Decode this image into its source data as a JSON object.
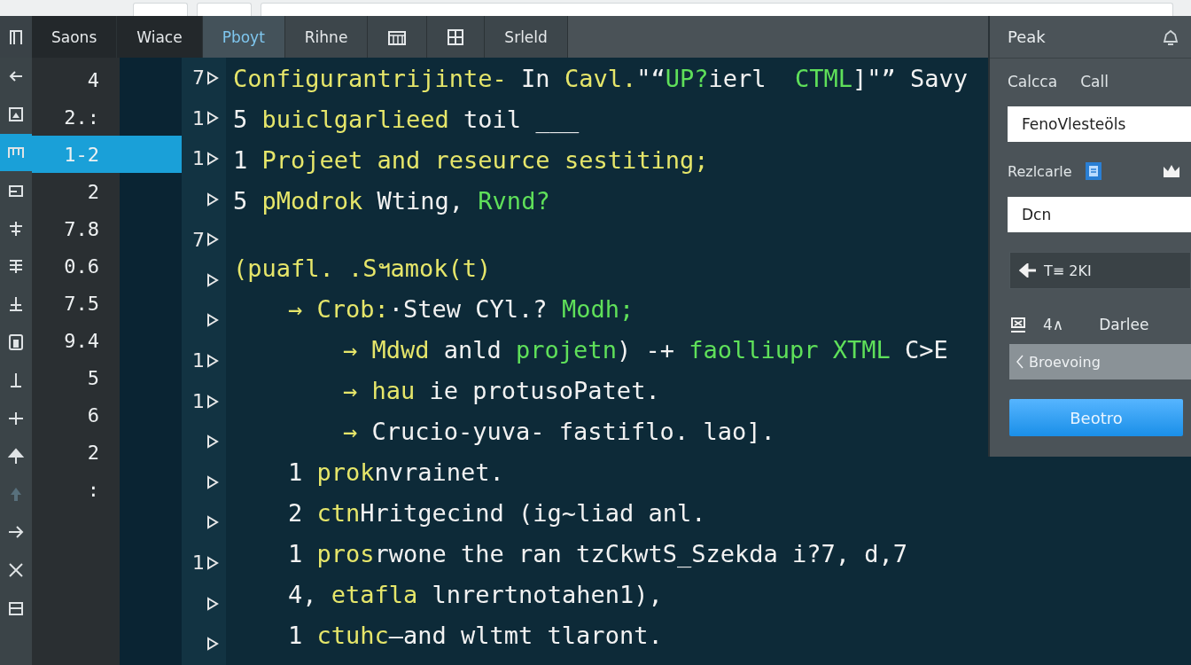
{
  "tab_bar": {
    "tabs": [
      {
        "kind": "text",
        "label": "Saons",
        "selected": false,
        "pinned": true
      },
      {
        "kind": "text",
        "label": "Wiace",
        "selected": false,
        "pinned": true
      },
      {
        "kind": "text",
        "label": "Pboyt",
        "selected": true,
        "pinned": false
      },
      {
        "kind": "text",
        "label": "Rihne",
        "selected": false,
        "pinned": false
      },
      {
        "kind": "icon",
        "selected": false,
        "pinned": false
      },
      {
        "kind": "icon",
        "selected": false,
        "pinned": false
      },
      {
        "kind": "text",
        "label": "Srleld",
        "selected": false,
        "pinned": false
      }
    ]
  },
  "activity_bar": {
    "items": [
      {
        "selected": false
      },
      {
        "selected": false
      },
      {
        "selected": true
      },
      {
        "selected": false
      },
      {
        "selected": false
      },
      {
        "selected": false
      },
      {
        "selected": false
      },
      {
        "selected": false
      },
      {
        "selected": false
      },
      {
        "selected": false
      },
      {
        "selected": false
      },
      {
        "selected": false
      },
      {
        "selected": false
      },
      {
        "selected": false
      },
      {
        "selected": false
      }
    ]
  },
  "values": [
    {
      "text": "4",
      "selected": false
    },
    {
      "text": "2.:",
      "selected": false
    },
    {
      "text": "1-2",
      "selected": true
    },
    {
      "text": "2",
      "selected": false
    },
    {
      "text": "7.8",
      "selected": false
    },
    {
      "text": "0.6",
      "selected": false
    },
    {
      "text": "7.5",
      "selected": false
    },
    {
      "text": "9.4",
      "selected": false
    },
    {
      "text": "5",
      "selected": false
    },
    {
      "text": "6",
      "selected": false
    },
    {
      "text": "2",
      "selected": false
    },
    {
      "text": ":",
      "selected": false
    }
  ],
  "gutter": [
    {
      "kind": "counted",
      "count": "7"
    },
    {
      "kind": "counted",
      "count": "1"
    },
    {
      "kind": "counted",
      "count": "1"
    },
    {
      "kind": "plain"
    },
    {
      "kind": "counted",
      "count": "7"
    },
    {
      "kind": "plain"
    },
    {
      "kind": "plain"
    },
    {
      "kind": "counted",
      "count": "1"
    },
    {
      "kind": "counted",
      "count": "1"
    },
    {
      "kind": "plain"
    },
    {
      "kind": "plain"
    },
    {
      "kind": "plain"
    },
    {
      "kind": "counted",
      "count": "1"
    },
    {
      "kind": "plain"
    },
    {
      "kind": "plain"
    }
  ],
  "code": [
    {
      "segments": [
        {
          "text": "Configurantrijinte-",
          "color": "#e6e66a"
        },
        {
          "text": " In ",
          "color": "#f2f2f2"
        },
        {
          "text": "Cavl.",
          "color": "#e6e66a"
        },
        {
          "text": "\"“",
          "color": "#f2f2f2"
        },
        {
          "text": "UP?",
          "color": "#5fe05a"
        },
        {
          "text": "ierl  ",
          "color": "#f2f2f2"
        },
        {
          "text": "CTML",
          "color": "#5fe05a"
        },
        {
          "text": "]\"” Savy",
          "color": "#f2f2f2"
        }
      ]
    },
    {
      "segments": [
        {
          "text": "5 ",
          "color": "#f2f2f2"
        },
        {
          "text": "buiclgarlieed",
          "color": "#e6e66a"
        },
        {
          "text": " toil ___",
          "color": "#f2f2f2"
        }
      ]
    },
    {
      "segments": [
        {
          "text": "1 ",
          "color": "#f2f2f2"
        },
        {
          "text": "Projeet and reseurce sestiting;",
          "color": "#e6e66a"
        }
      ]
    },
    {
      "segments": [
        {
          "text": "5 ",
          "color": "#f2f2f2"
        },
        {
          "text": "pModrok",
          "color": "#e6e66a"
        },
        {
          "text": " Wting, ",
          "color": "#f2f2f2"
        },
        {
          "text": "Rvnd?",
          "color": "#5fe05a"
        }
      ]
    },
    {
      "segments": [
        {
          "text": "(puafl. .Sฯamok(t)",
          "color": "#e6e66a"
        }
      ],
      "children": [
        {
          "segments": [
            {
              "text": "→ ",
              "color": "#e6e66a"
            },
            {
              "text": "Crob:",
              "color": "#e6e66a"
            },
            {
              "text": "·Stew CYl.? ",
              "color": "#f2f2f2"
            },
            {
              "text": "Modh;",
              "color": "#5fe05a"
            }
          ],
          "children": [
            {
              "segments": [
                {
                  "text": "→ ",
                  "color": "#e6e66a"
                },
                {
                  "text": "Mdwd",
                  "color": "#e6e66a"
                },
                {
                  "text": " anld ",
                  "color": "#f2f2f2"
                },
                {
                  "text": "projetn",
                  "color": "#5fe05a"
                },
                {
                  "text": ") -+ ",
                  "color": "#f2f2f2"
                },
                {
                  "text": "faolliupr XTML",
                  "color": "#5fe05a"
                },
                {
                  "text": " C>E",
                  "color": "#f2f2f2"
                }
              ]
            },
            {
              "segments": [
                {
                  "text": "→ ",
                  "color": "#e6e66a"
                },
                {
                  "text": "hau",
                  "color": "#e6e66a"
                },
                {
                  "text": " ie protusoPatet.",
                  "color": "#f2f2f2"
                }
              ]
            },
            {
              "segments": [
                {
                  "text": "→ ",
                  "color": "#e6e66a"
                },
                {
                  "text": "Crucio-yuva- fastiflo. lao].",
                  "color": "#f2f2f2"
                }
              ]
            }
          ]
        },
        {
          "segments": [
            {
              "text": "1 ",
              "color": "#f2f2f2"
            },
            {
              "text": "prok",
              "color": "#e6e66a"
            },
            {
              "text": "nvrainet.",
              "color": "#f2f2f2"
            }
          ]
        },
        {
          "segments": [
            {
              "text": "2 ",
              "color": "#f2f2f2"
            },
            {
              "text": "ctn",
              "color": "#e6e66a"
            },
            {
              "text": "Hritgecind (ig~liad anl.",
              "color": "#f2f2f2"
            }
          ]
        },
        {
          "segments": [
            {
              "text": "1 ",
              "color": "#f2f2f2"
            },
            {
              "text": "pros",
              "color": "#e6e66a"
            },
            {
              "text": "rwone the ran tzCkwtS_Szekda i?7, d,7",
              "color": "#f2f2f2"
            }
          ]
        },
        {
          "segments": [
            {
              "text": "4, ",
              "color": "#f2f2f2"
            },
            {
              "text": "etafla",
              "color": "#e6e66a"
            },
            {
              "text": " lnrertnotahen1),",
              "color": "#f2f2f2"
            }
          ]
        },
        {
          "segments": [
            {
              "text": "1 ",
              "color": "#f2f2f2"
            },
            {
              "text": "ctuhc",
              "color": "#e6e66a"
            },
            {
              "text": "—and wltmt tlaront.",
              "color": "#f2f2f2"
            }
          ]
        }
      ]
    }
  ],
  "panel": {
    "title": "Peak",
    "labels": [
      "Calcca",
      "Call"
    ],
    "name_field": {
      "value": "FenoVlesteöls"
    },
    "section_label": "Rezlcarle",
    "second_field": {
      "value": "Dcn"
    },
    "path_bar": {
      "text": "T≡ 2KI"
    },
    "count": "4∧",
    "action_label": "Darlee",
    "search_field": {
      "placeholder": "Broevoing"
    },
    "button": "Beotro"
  }
}
